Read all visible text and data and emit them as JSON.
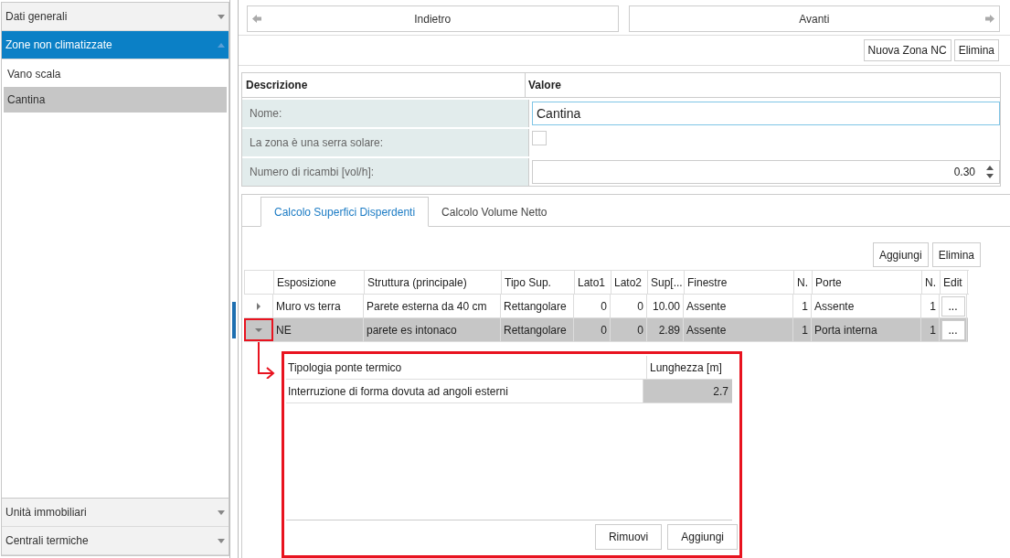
{
  "sidebar": {
    "sections": [
      {
        "label": "Dati generali",
        "expanded": false
      },
      {
        "label": "Zone non climatizzate",
        "expanded": true,
        "items": [
          {
            "label": "Vano scala",
            "selected": false
          },
          {
            "label": "Cantina",
            "selected": true
          }
        ]
      },
      {
        "label": "Unità immobiliari",
        "expanded": false
      },
      {
        "label": "Centrali termiche",
        "expanded": false
      }
    ]
  },
  "nav": {
    "back": "Indietro",
    "forward": "Avanti"
  },
  "actions": [
    "Nuova Zona NC",
    "Elimina"
  ],
  "properties": {
    "columns": [
      "Descrizione",
      "Valore"
    ],
    "rows": [
      {
        "kind": "text",
        "label": "Nome:",
        "value": "Cantina"
      },
      {
        "kind": "checkbox",
        "label": "La zona è una serra solare:",
        "checked": false
      },
      {
        "kind": "number",
        "label": "Numero di ricambi [vol/h]:",
        "value": "0.30"
      }
    ]
  },
  "tabs": [
    {
      "label": "Calcolo Superfici Disperdenti",
      "selected": true
    },
    {
      "label": "Calcolo Volume Netto",
      "selected": false
    }
  ],
  "grid_actions": [
    "Aggiungi",
    "Elimina"
  ],
  "grid": {
    "columns": [
      "Esposizione",
      "Struttura (principale)",
      "Tipo Sup.",
      "Lato1",
      "Lato2",
      "Sup[...",
      "Finestre",
      "N.",
      "Porte",
      "N.",
      "Edit"
    ],
    "rows": [
      {
        "cells": [
          "Muro vs terra",
          "Parete esterna da 40 cm",
          "Rettangolare",
          "0",
          "0",
          "10.00",
          "Assente",
          "1",
          "Assente",
          "1"
        ],
        "edit": "...",
        "expanded": false,
        "selected": false
      },
      {
        "cells": [
          "NE",
          "parete es intonaco",
          "Rettangolare",
          "0",
          "0",
          "2.89",
          "Assente",
          "1",
          "Porta interna",
          "1"
        ],
        "edit": "...",
        "expanded": true,
        "selected": true
      }
    ]
  },
  "detail": {
    "columns": [
      "Tipologia ponte termico",
      "Lunghezza [m]"
    ],
    "rows": [
      {
        "cells": [
          "Interruzione di forma dovuta ad angoli esterni",
          "2.7"
        ]
      }
    ],
    "buttons": [
      "Rimuovi",
      "Aggiungi"
    ]
  }
}
